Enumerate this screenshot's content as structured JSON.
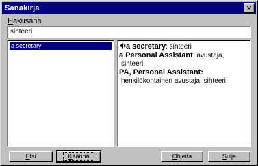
{
  "window": {
    "title": "Sanakirja",
    "close_glyph": "✕"
  },
  "search": {
    "label_mnemonic": "H",
    "label_rest": "akusana",
    "value": "sihteeri"
  },
  "word_list": {
    "items": [
      {
        "label": "a secretary",
        "selected": true
      }
    ]
  },
  "translation": {
    "icon": "speaker-icon",
    "entries": [
      {
        "term": "a secretary",
        "sep": ": ",
        "text1": "sihteeri",
        "text2": ""
      },
      {
        "term": "a Personal Assistant",
        "sep": ": ",
        "text1": "avustaja,",
        "text2": "sihteeri"
      },
      {
        "term": "PA, Personal Assistant",
        "sep": ":",
        "text1": "",
        "text2": "henkilökohtainen avustaja; sihteeri"
      }
    ]
  },
  "buttons": {
    "etsi": {
      "mnemonic": "E",
      "rest": "tsi"
    },
    "kaanna": {
      "mnemonic": "K",
      "rest": "äännä"
    },
    "ohjeita": {
      "mnemonic": "O",
      "rest": "hjeita"
    },
    "sulje": {
      "mnemonic": "S",
      "rest": "ulje"
    }
  },
  "colors": {
    "titlebar": "#000080",
    "selection": "#000080",
    "face": "#c0c0c0"
  }
}
